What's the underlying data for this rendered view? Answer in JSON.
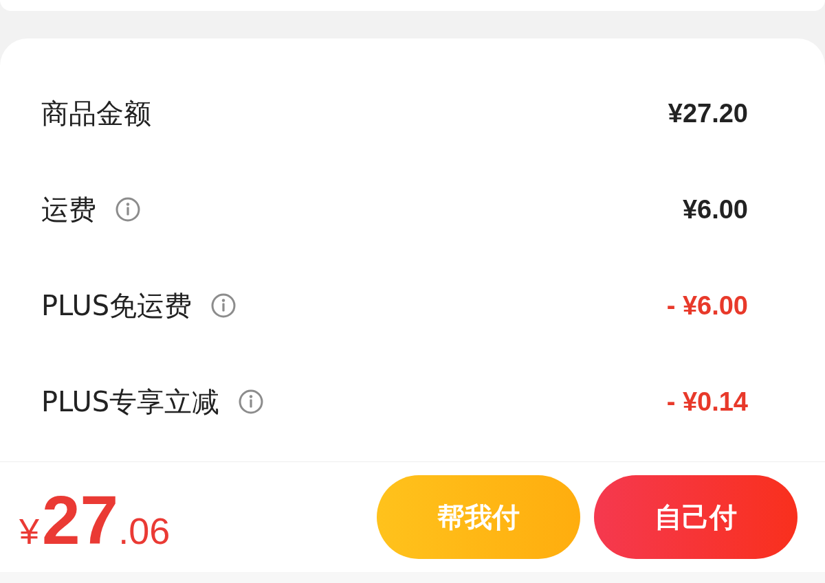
{
  "fee_rows": [
    {
      "label": "商品金额",
      "value": "¥27.20",
      "kind": "charge",
      "info": false
    },
    {
      "label": "运费",
      "value": "¥6.00",
      "kind": "charge",
      "info": true
    },
    {
      "label": "PLUS免运费",
      "value": "- ¥6.00",
      "kind": "discount",
      "info": true
    },
    {
      "label": "PLUS专享立减",
      "value": "- ¥0.14",
      "kind": "discount",
      "info": true
    }
  ],
  "footer": {
    "total": {
      "currency": "¥",
      "integer": "27",
      "decimal": ".06"
    },
    "buttons": [
      {
        "label": "帮我付",
        "kind": "secondary"
      },
      {
        "label": "自己付",
        "kind": "primary"
      }
    ]
  }
}
